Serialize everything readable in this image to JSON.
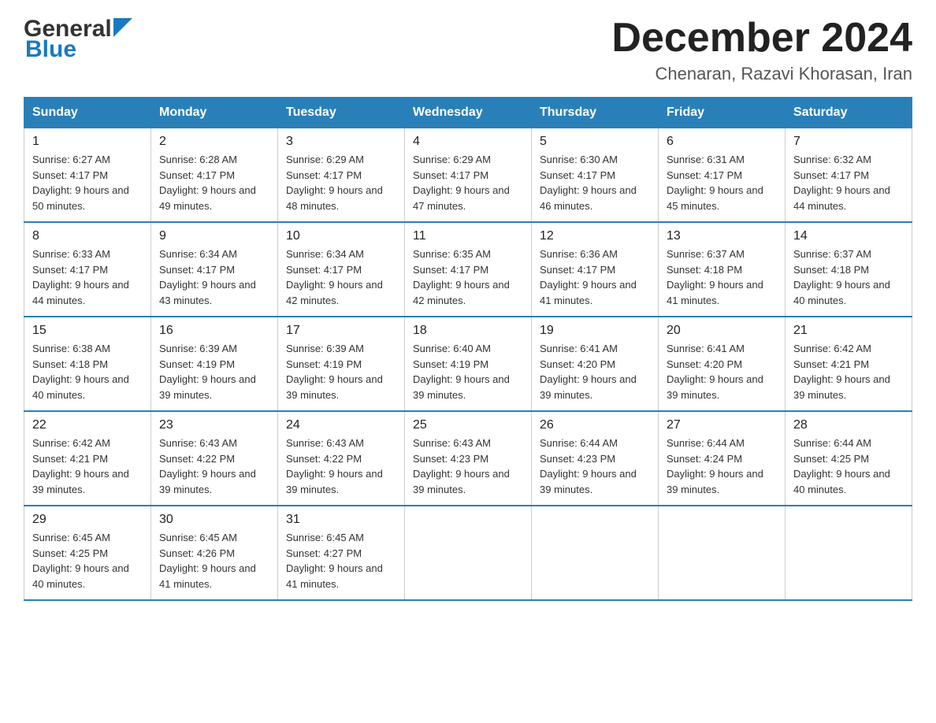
{
  "header": {
    "logo_general": "General",
    "logo_blue": "Blue",
    "month_title": "December 2024",
    "location": "Chenaran, Razavi Khorasan, Iran"
  },
  "days_of_week": [
    "Sunday",
    "Monday",
    "Tuesday",
    "Wednesday",
    "Thursday",
    "Friday",
    "Saturday"
  ],
  "weeks": [
    [
      {
        "day": "1",
        "sunrise": "6:27 AM",
        "sunset": "4:17 PM",
        "daylight": "9 hours and 50 minutes."
      },
      {
        "day": "2",
        "sunrise": "6:28 AM",
        "sunset": "4:17 PM",
        "daylight": "9 hours and 49 minutes."
      },
      {
        "day": "3",
        "sunrise": "6:29 AM",
        "sunset": "4:17 PM",
        "daylight": "9 hours and 48 minutes."
      },
      {
        "day": "4",
        "sunrise": "6:29 AM",
        "sunset": "4:17 PM",
        "daylight": "9 hours and 47 minutes."
      },
      {
        "day": "5",
        "sunrise": "6:30 AM",
        "sunset": "4:17 PM",
        "daylight": "9 hours and 46 minutes."
      },
      {
        "day": "6",
        "sunrise": "6:31 AM",
        "sunset": "4:17 PM",
        "daylight": "9 hours and 45 minutes."
      },
      {
        "day": "7",
        "sunrise": "6:32 AM",
        "sunset": "4:17 PM",
        "daylight": "9 hours and 44 minutes."
      }
    ],
    [
      {
        "day": "8",
        "sunrise": "6:33 AM",
        "sunset": "4:17 PM",
        "daylight": "9 hours and 44 minutes."
      },
      {
        "day": "9",
        "sunrise": "6:34 AM",
        "sunset": "4:17 PM",
        "daylight": "9 hours and 43 minutes."
      },
      {
        "day": "10",
        "sunrise": "6:34 AM",
        "sunset": "4:17 PM",
        "daylight": "9 hours and 42 minutes."
      },
      {
        "day": "11",
        "sunrise": "6:35 AM",
        "sunset": "4:17 PM",
        "daylight": "9 hours and 42 minutes."
      },
      {
        "day": "12",
        "sunrise": "6:36 AM",
        "sunset": "4:17 PM",
        "daylight": "9 hours and 41 minutes."
      },
      {
        "day": "13",
        "sunrise": "6:37 AM",
        "sunset": "4:18 PM",
        "daylight": "9 hours and 41 minutes."
      },
      {
        "day": "14",
        "sunrise": "6:37 AM",
        "sunset": "4:18 PM",
        "daylight": "9 hours and 40 minutes."
      }
    ],
    [
      {
        "day": "15",
        "sunrise": "6:38 AM",
        "sunset": "4:18 PM",
        "daylight": "9 hours and 40 minutes."
      },
      {
        "day": "16",
        "sunrise": "6:39 AM",
        "sunset": "4:19 PM",
        "daylight": "9 hours and 39 minutes."
      },
      {
        "day": "17",
        "sunrise": "6:39 AM",
        "sunset": "4:19 PM",
        "daylight": "9 hours and 39 minutes."
      },
      {
        "day": "18",
        "sunrise": "6:40 AM",
        "sunset": "4:19 PM",
        "daylight": "9 hours and 39 minutes."
      },
      {
        "day": "19",
        "sunrise": "6:41 AM",
        "sunset": "4:20 PM",
        "daylight": "9 hours and 39 minutes."
      },
      {
        "day": "20",
        "sunrise": "6:41 AM",
        "sunset": "4:20 PM",
        "daylight": "9 hours and 39 minutes."
      },
      {
        "day": "21",
        "sunrise": "6:42 AM",
        "sunset": "4:21 PM",
        "daylight": "9 hours and 39 minutes."
      }
    ],
    [
      {
        "day": "22",
        "sunrise": "6:42 AM",
        "sunset": "4:21 PM",
        "daylight": "9 hours and 39 minutes."
      },
      {
        "day": "23",
        "sunrise": "6:43 AM",
        "sunset": "4:22 PM",
        "daylight": "9 hours and 39 minutes."
      },
      {
        "day": "24",
        "sunrise": "6:43 AM",
        "sunset": "4:22 PM",
        "daylight": "9 hours and 39 minutes."
      },
      {
        "day": "25",
        "sunrise": "6:43 AM",
        "sunset": "4:23 PM",
        "daylight": "9 hours and 39 minutes."
      },
      {
        "day": "26",
        "sunrise": "6:44 AM",
        "sunset": "4:23 PM",
        "daylight": "9 hours and 39 minutes."
      },
      {
        "day": "27",
        "sunrise": "6:44 AM",
        "sunset": "4:24 PM",
        "daylight": "9 hours and 39 minutes."
      },
      {
        "day": "28",
        "sunrise": "6:44 AM",
        "sunset": "4:25 PM",
        "daylight": "9 hours and 40 minutes."
      }
    ],
    [
      {
        "day": "29",
        "sunrise": "6:45 AM",
        "sunset": "4:25 PM",
        "daylight": "9 hours and 40 minutes."
      },
      {
        "day": "30",
        "sunrise": "6:45 AM",
        "sunset": "4:26 PM",
        "daylight": "9 hours and 41 minutes."
      },
      {
        "day": "31",
        "sunrise": "6:45 AM",
        "sunset": "4:27 PM",
        "daylight": "9 hours and 41 minutes."
      },
      null,
      null,
      null,
      null
    ]
  ]
}
